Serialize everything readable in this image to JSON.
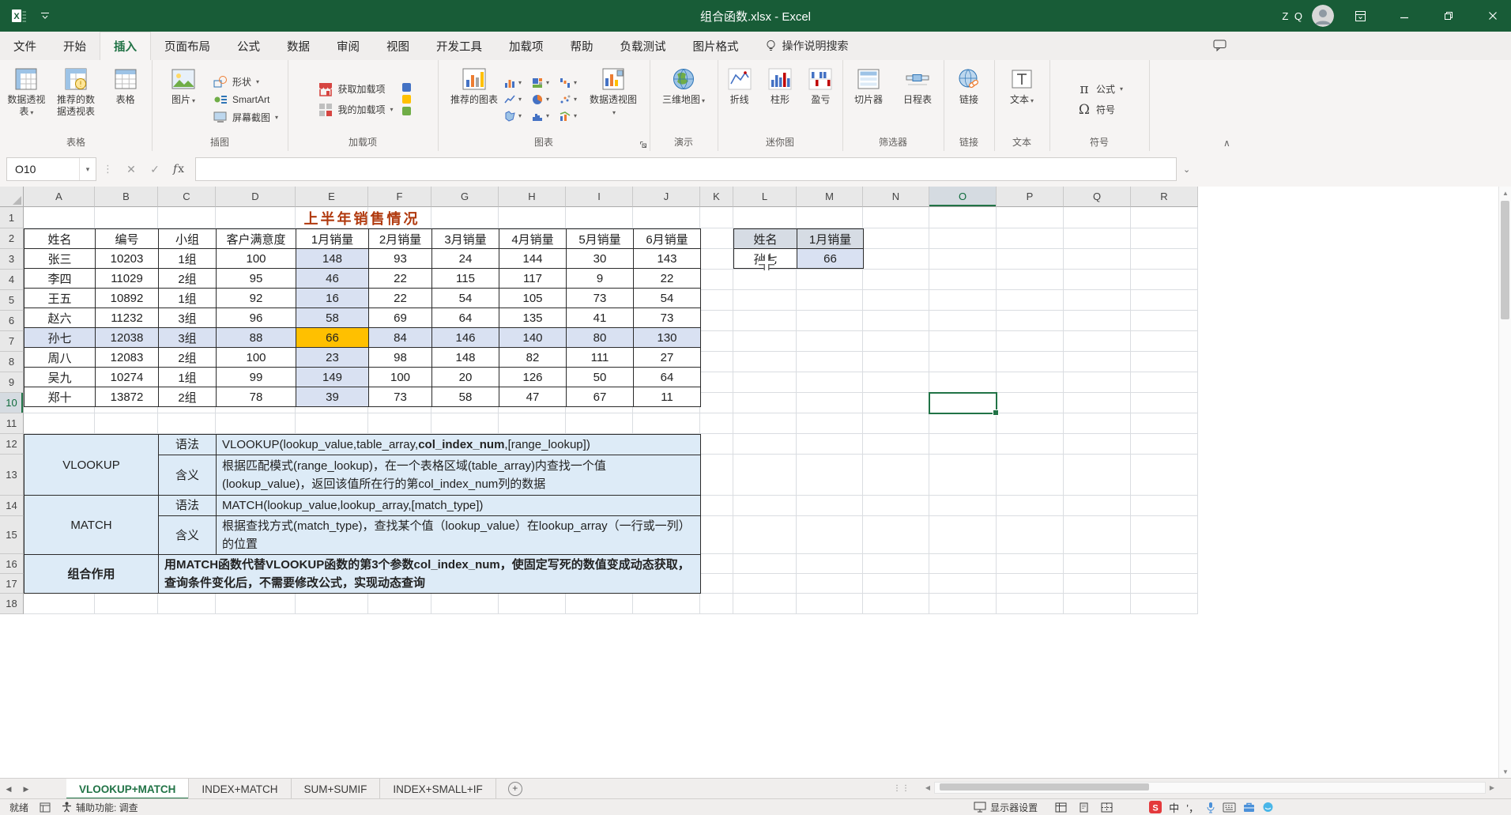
{
  "titlebar": {
    "title": "组合函数.xlsx - Excel",
    "user": "Z Q"
  },
  "tabs": {
    "items": [
      "文件",
      "开始",
      "插入",
      "页面布局",
      "公式",
      "数据",
      "审阅",
      "视图",
      "开发工具",
      "加载项",
      "帮助",
      "负载测试",
      "图片格式"
    ],
    "active": "插入",
    "search": "操作说明搜索"
  },
  "ribbon": {
    "groups": [
      {
        "name": "表格",
        "buttons": [
          {
            "label": "数据透视表",
            "icon": "pivot-table-icon",
            "dropdown": true
          },
          {
            "label": "推荐的数据透视表",
            "icon": "recommended-pivot-icon",
            "dropdown": false
          },
          {
            "label": "表格",
            "icon": "table-icon",
            "dropdown": false
          }
        ]
      },
      {
        "name": "插图",
        "big": [
          {
            "label": "图片",
            "icon": "picture-icon",
            "dropdown": true
          }
        ],
        "small": [
          {
            "label": "形状",
            "icon": "shapes-icon",
            "dropdown": true
          },
          {
            "label": "SmartArt",
            "icon": "smartart-icon",
            "dropdown": false
          },
          {
            "label": "屏幕截图",
            "icon": "screenshot-icon",
            "dropdown": true
          }
        ]
      },
      {
        "name": "加载项",
        "small": [
          {
            "label": "获取加载项",
            "icon": "store-icon",
            "dropdown": false
          },
          {
            "label": "我的加载项",
            "icon": "my-addins-icon",
            "dropdown": true
          }
        ]
      },
      {
        "name": "图表",
        "dialog": true,
        "big1": {
          "label": "推荐的图表",
          "icon": "recommended-charts-icon",
          "dropdown": false
        },
        "minis": [
          "mini-column-chart-icon",
          "mini-hierarchy-chart-icon",
          "mini-waterfall-chart-icon",
          "mini-line-chart-icon",
          "mini-pie-chart-icon",
          "mini-scatter-chart-icon",
          "mini-map-chart-icon",
          "mini-histogram-chart-icon",
          "mini-combo-chart-icon"
        ],
        "big2": {
          "label": "数据透视图",
          "icon": "pivot-chart-icon",
          "dropdown": true
        }
      },
      {
        "name": "演示",
        "buttons": [
          {
            "label": "三维地图",
            "icon": "map-3d-icon",
            "dropdown": true
          }
        ]
      },
      {
        "name": "迷你图",
        "buttons": [
          {
            "label": "折线",
            "icon": "sparkline-line-icon",
            "dropdown": false
          },
          {
            "label": "柱形",
            "icon": "sparkline-column-icon",
            "dropdown": false
          },
          {
            "label": "盈亏",
            "icon": "sparkline-winloss-icon",
            "dropdown": false
          }
        ]
      },
      {
        "name": "筛选器",
        "buttons": [
          {
            "label": "切片器",
            "icon": "slicer-icon",
            "dropdown": false
          },
          {
            "label": "日程表",
            "icon": "timeline-icon",
            "dropdown": false
          }
        ]
      },
      {
        "name": "链接",
        "buttons": [
          {
            "label": "链接",
            "icon": "link-icon",
            "dropdown": false
          }
        ]
      },
      {
        "name": "文本",
        "buttons": [
          {
            "label": "文本",
            "icon": "text-box-icon",
            "dropdown": true
          }
        ]
      },
      {
        "name": "符号",
        "small": [
          {
            "label": "公式",
            "icon": "equation-icon",
            "dropdown": true
          },
          {
            "label": "符号",
            "icon": "symbol-icon",
            "dropdown": false
          }
        ]
      }
    ]
  },
  "formula_bar": {
    "name_box": "O10",
    "formula": ""
  },
  "sheet": {
    "title": "上半年销售情况",
    "columns": [
      "A",
      "B",
      "C",
      "D",
      "E",
      "F",
      "G",
      "H",
      "I",
      "J",
      "K",
      "L",
      "M",
      "N",
      "O",
      "P",
      "Q",
      "R"
    ],
    "visible_rows": 18,
    "table": {
      "headers": [
        "姓名",
        "编号",
        "小组",
        "客户满意度",
        "1月销量",
        "2月销量",
        "3月销量",
        "4月销量",
        "5月销量",
        "6月销量"
      ],
      "rows": [
        [
          "张三",
          "10203",
          "1组",
          "100",
          "148",
          "93",
          "24",
          "144",
          "30",
          "143"
        ],
        [
          "李四",
          "11029",
          "2组",
          "95",
          "46",
          "22",
          "115",
          "117",
          "9",
          "22"
        ],
        [
          "王五",
          "10892",
          "1组",
          "92",
          "16",
          "22",
          "54",
          "105",
          "73",
          "54"
        ],
        [
          "赵六",
          "11232",
          "3组",
          "96",
          "58",
          "69",
          "64",
          "135",
          "41",
          "73"
        ],
        [
          "孙七",
          "12038",
          "3组",
          "88",
          "66",
          "84",
          "146",
          "140",
          "80",
          "130"
        ],
        [
          "周八",
          "12083",
          "2组",
          "100",
          "23",
          "98",
          "148",
          "82",
          "111",
          "27"
        ],
        [
          "吴九",
          "10274",
          "1组",
          "99",
          "149",
          "100",
          "20",
          "126",
          "50",
          "64"
        ],
        [
          "郑十",
          "13872",
          "2组",
          "78",
          "39",
          "73",
          "58",
          "47",
          "67",
          "11"
        ]
      ],
      "highlight_column_header": "1月销量",
      "highlight_row_name": "孙七"
    },
    "lookup": {
      "headers": [
        "姓名",
        "1月销量"
      ],
      "values": [
        "孙七",
        "66"
      ]
    },
    "docs": {
      "syntax_label": "语法",
      "meaning_label": "含义",
      "vlookup": {
        "label": "VLOOKUP",
        "syntax_pre": "VLOOKUP(lookup_value,table_array,",
        "syntax_bold": "col_index_num",
        "syntax_post": ",[range_lookup])",
        "meaning": "根据匹配模式(range_lookup)，在一个表格区域(table_array)内查找一个值(lookup_value)，返回该值所在行的第col_index_num列的数据"
      },
      "match": {
        "label": "MATCH",
        "syntax": "MATCH(lookup_value,lookup_array,[match_type])",
        "meaning": "根据查找方式(match_type)，查找某个值（lookup_value）在lookup_array（一行或一列）的位置"
      },
      "combo": {
        "label": "组合作用",
        "text": "用MATCH函数代替VLOOKUP函数的第3个参数col_index_num，使固定写死的数值变成动态获取，查询条件变化后，不需要修改公式，实现动态查询"
      }
    },
    "selection": {
      "cell": "O10"
    }
  },
  "sheet_tabs": {
    "items": [
      "VLOOKUP+MATCH",
      "INDEX+MATCH",
      "SUM+SUMIF",
      "INDEX+SMALL+IF"
    ],
    "active": "VLOOKUP+MATCH"
  },
  "status_bar": {
    "ready": "就绪",
    "accessibility": "辅助功能: 调查",
    "display_settings": "显示器设置",
    "ime": {
      "lang": "中",
      "punct": "’，"
    }
  },
  "colors": {
    "title_bar": "#185C37",
    "accent": "#217346",
    "column_fill": "#D9E1F2",
    "row_fill": "#D9E1F2",
    "highlight_fill": "#FFC000",
    "doc_fill": "#DDEBF7",
    "lookup_header_fill": "#D6DCE4",
    "table_title_color": "#B0390E"
  }
}
